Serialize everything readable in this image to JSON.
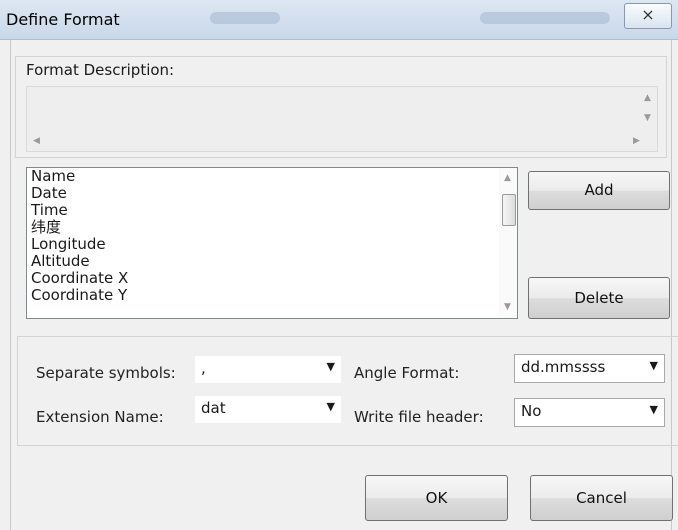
{
  "window": {
    "title": "Define Format",
    "close_glyph": "⨯"
  },
  "format_description": {
    "label": "Format Description:",
    "value": ""
  },
  "fields_list": {
    "items": [
      "Name",
      "Date",
      "Time",
      "纬度",
      "Longitude",
      "Altitude",
      "Coordinate X",
      "Coordinate Y"
    ]
  },
  "buttons": {
    "add": "Add",
    "delete": "Delete",
    "ok": "OK",
    "cancel": "Cancel"
  },
  "settings": {
    "separate_symbols": {
      "label": "Separate symbols:",
      "value": ","
    },
    "extension_name": {
      "label": "Extension Name:",
      "value": "dat"
    },
    "angle_format": {
      "label": "Angle Format:",
      "value": "dd.mmssss"
    },
    "write_file_header": {
      "label": "Write file header:",
      "value": "No"
    }
  }
}
